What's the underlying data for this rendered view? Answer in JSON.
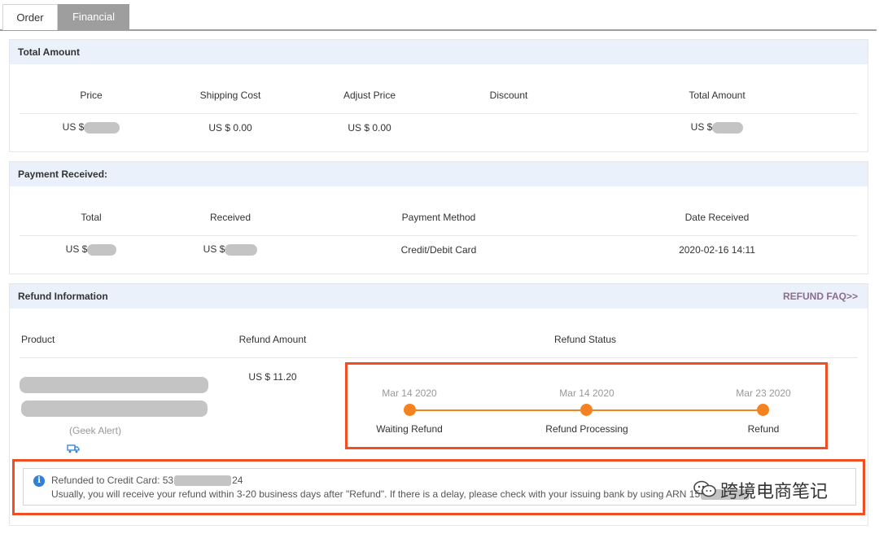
{
  "tabs": {
    "order": "Order",
    "financial": "Financial"
  },
  "total_amount": {
    "title": "Total Amount",
    "headers": {
      "price": "Price",
      "shipping": "Shipping Cost",
      "adjust": "Adjust Price",
      "discount": "Discount",
      "total": "Total Amount"
    },
    "values": {
      "price": "US $",
      "shipping": "US $ 0.00",
      "adjust": "US $ 0.00",
      "discount": "",
      "total": "US $"
    }
  },
  "payment": {
    "title": "Payment Received:",
    "headers": {
      "total": "Total",
      "received": "Received",
      "method": "Payment Method",
      "date": "Date Received"
    },
    "values": {
      "total": "US $",
      "received": "US $",
      "method": "Credit/Debit Card",
      "date": "2020-02-16 14:11"
    }
  },
  "refund": {
    "title": "Refund Information",
    "faq_link": "REFUND FAQ>>",
    "headers": {
      "product": "Product",
      "amount": "Refund Amount",
      "status": "Refund Status"
    },
    "product_tag": "(Geek Alert)",
    "amount": "US $ 11.20",
    "steps": [
      {
        "date": "Mar 14 2020",
        "label": "Waiting Refund"
      },
      {
        "date": "Mar 14 2020",
        "label": "Refund Processing"
      },
      {
        "date": "Mar 23 2020",
        "label": "Refund"
      }
    ],
    "notice": {
      "card_prefix": "Refunded to Credit Card: 53",
      "card_suffix": "24",
      "message": "Usually, you will receive your refund within 3-20 business days after \"Refund\". If there is a delay, please check with your issuing bank by using ARN 15",
      "watermark": "跨境电商笔记"
    }
  },
  "colors": {
    "accent": "#f58220",
    "highlight": "#f04e23",
    "header_bg": "#eaf1fb",
    "link": "#8a6d8f"
  }
}
